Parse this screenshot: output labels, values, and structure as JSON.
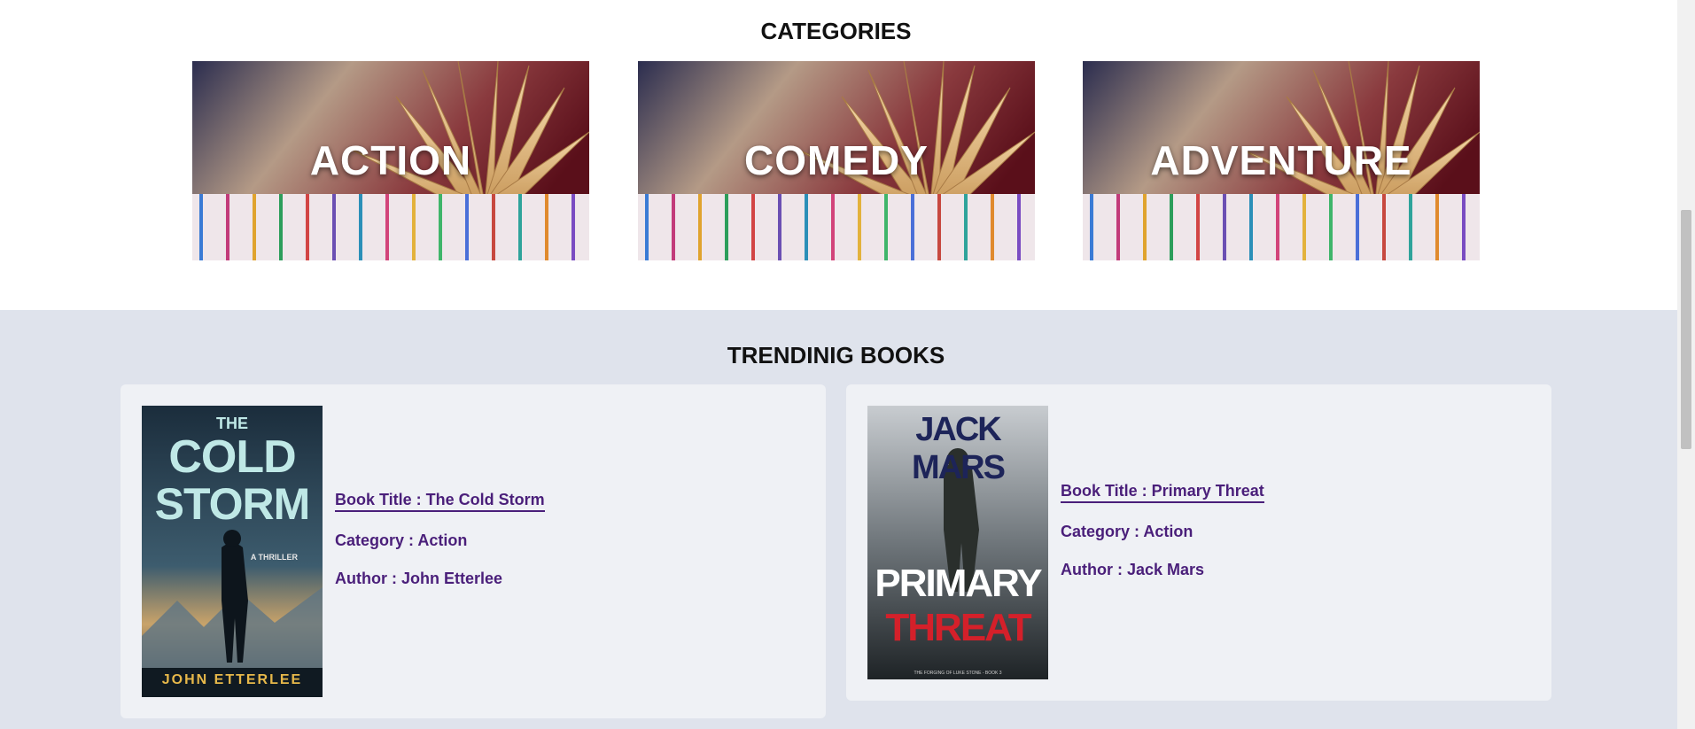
{
  "categories": {
    "heading": "CATEGORIES",
    "items": [
      {
        "label": "ACTION"
      },
      {
        "label": "COMEDY"
      },
      {
        "label": "ADVENTURE"
      }
    ]
  },
  "trending": {
    "heading": "TRENDINIG BOOKS",
    "books": [
      {
        "cover": {
          "line1": "THE",
          "line2": "COLD",
          "line3": "STORM",
          "tagline": "A THRILLER",
          "author": "JOHN ETTERLEE"
        },
        "title": "Book Title : The Cold Storm",
        "category": "Category : Action",
        "author": "Author : John Etterlee"
      },
      {
        "cover": {
          "author": "JACK MARS",
          "line1": "PRIMARY",
          "line2": "THREAT",
          "series": "THE FORGING OF LUKE STONE - BOOK 3"
        },
        "title": "Book Title : Primary Threat",
        "category": "Category : Action",
        "author": "Author : Jack Mars"
      }
    ]
  },
  "colors": {
    "link": "#4a1f7a",
    "section_bg": "#dfe3ec",
    "card_bg": "#eff1f5"
  }
}
